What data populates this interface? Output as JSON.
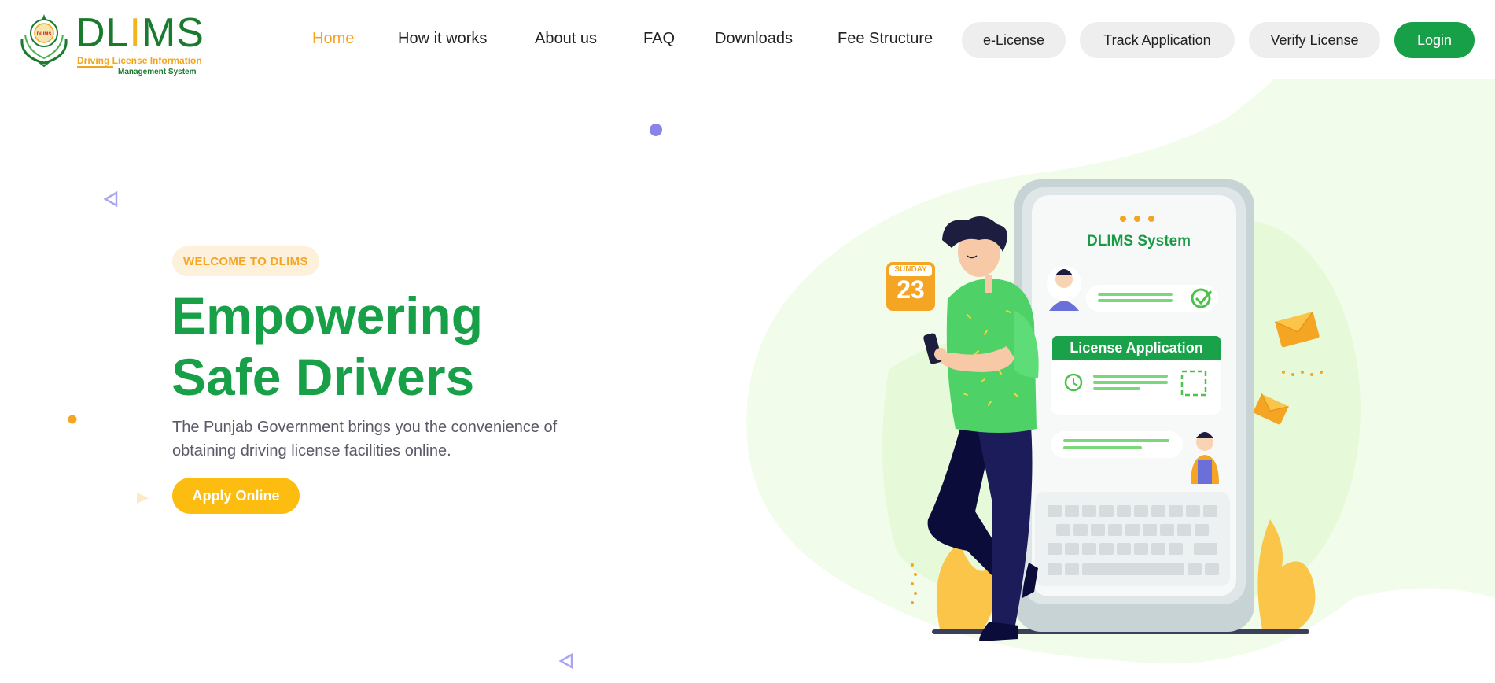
{
  "brand": {
    "name_prefix": "DL",
    "name_i": "I",
    "name_suffix": "MS",
    "tagline_line1": "Driving License Information",
    "tagline_line2": "Management System",
    "seal_text": "DLIMS",
    "primary_color": "#17a047",
    "accent_color": "#f5a524"
  },
  "nav": {
    "items": [
      {
        "label": "Home",
        "active": true
      },
      {
        "label": "How it works",
        "active": false
      },
      {
        "label": "About us",
        "active": false
      },
      {
        "label": "FAQ",
        "active": false
      },
      {
        "label": "Downloads",
        "active": false
      },
      {
        "label": "Fee Structure",
        "active": false
      }
    ],
    "pills": [
      "e-License",
      "Track Application",
      "Verify License"
    ],
    "login_label": "Login"
  },
  "hero": {
    "badge": "WELCOME TO DLIMS",
    "headline_line1": "Empowering",
    "headline_line2": "Safe Drivers",
    "lead": "The Punjab Government brings you the convenience of obtaining driving license facilities online.",
    "cta_label": "Apply Online"
  },
  "illustration": {
    "phone_title": "DLIMS System",
    "card_title": "License Application",
    "calendar_day": "SUNDAY",
    "calendar_date": "23"
  }
}
